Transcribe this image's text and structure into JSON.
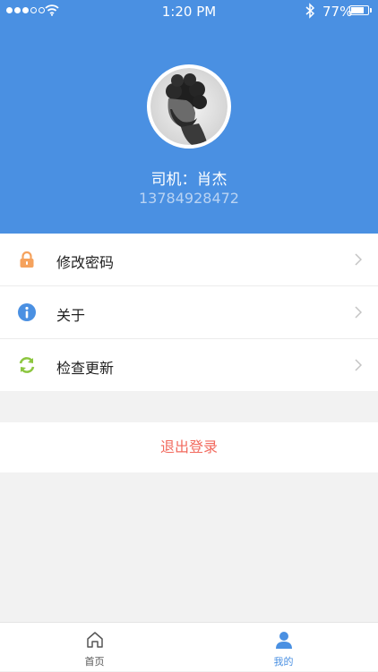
{
  "status_bar": {
    "time": "1:20 PM",
    "battery_percent": "77%",
    "battery_level": 0.77,
    "signal_bars": 3,
    "signal_total": 5,
    "icons": [
      "signal-icon",
      "wifi-icon",
      "bluetooth-icon",
      "battery-icon"
    ]
  },
  "profile": {
    "name": "司机：肖杰",
    "phone": "13784928472",
    "avatar_icon": "avatar-photo"
  },
  "menu": {
    "items": [
      {
        "label": "修改密码",
        "icon": "lock-icon",
        "icon_color": "#f5a25d"
      },
      {
        "label": "关于",
        "icon": "info-icon",
        "icon_color": "#4a90e2"
      },
      {
        "label": "检查更新",
        "icon": "refresh-icon",
        "icon_color": "#8cc63f"
      }
    ]
  },
  "logout": {
    "label": "退出登录",
    "color": "#f26a5e"
  },
  "tabbar": {
    "tabs": [
      {
        "label": "首页",
        "icon": "home-icon",
        "active": false
      },
      {
        "label": "我的",
        "icon": "user-icon",
        "active": true
      }
    ]
  },
  "colors": {
    "header_bg": "#4a90e2",
    "accent": "#4a90e2",
    "page_bg": "#f2f2f2"
  }
}
